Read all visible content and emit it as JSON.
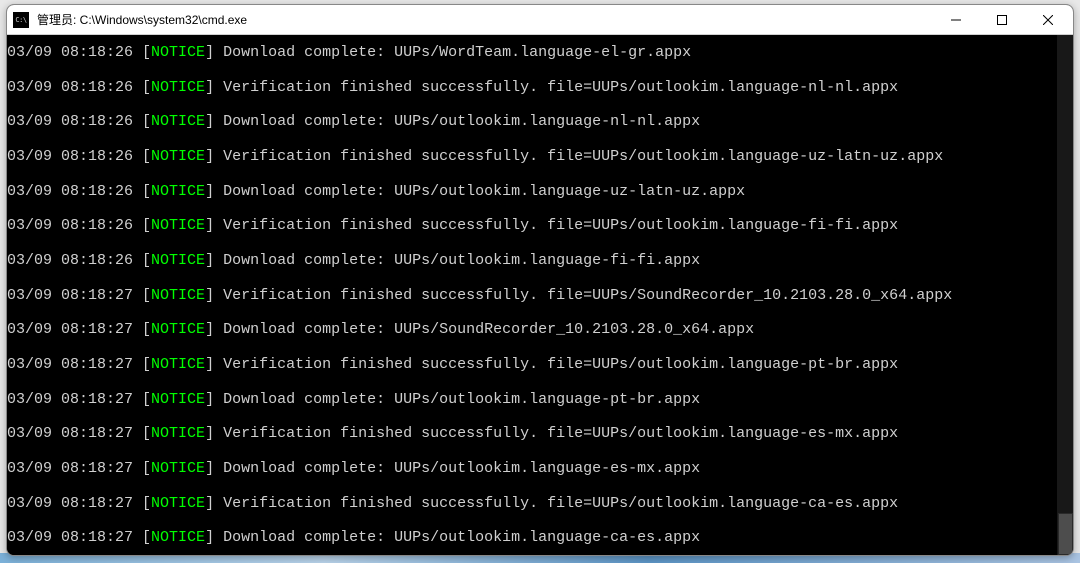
{
  "window": {
    "title": "管理员: C:\\Windows\\system32\\cmd.exe",
    "icon_label": "C:\\"
  },
  "log": [
    {
      "ts": "03/09 08:18:26",
      "level": "NOTICE",
      "msg": "Download complete: UUPs/WordTeam.language-el-gr.appx"
    },
    {
      "ts": "03/09 08:18:26",
      "level": "NOTICE",
      "msg": "Verification finished successfully. file=UUPs/outlookim.language-nl-nl.appx"
    },
    {
      "ts": "03/09 08:18:26",
      "level": "NOTICE",
      "msg": "Download complete: UUPs/outlookim.language-nl-nl.appx"
    },
    {
      "ts": "03/09 08:18:26",
      "level": "NOTICE",
      "msg": "Verification finished successfully. file=UUPs/outlookim.language-uz-latn-uz.appx"
    },
    {
      "ts": "03/09 08:18:26",
      "level": "NOTICE",
      "msg": "Download complete: UUPs/outlookim.language-uz-latn-uz.appx"
    },
    {
      "ts": "03/09 08:18:26",
      "level": "NOTICE",
      "msg": "Verification finished successfully. file=UUPs/outlookim.language-fi-fi.appx"
    },
    {
      "ts": "03/09 08:18:26",
      "level": "NOTICE",
      "msg": "Download complete: UUPs/outlookim.language-fi-fi.appx"
    },
    {
      "ts": "03/09 08:18:27",
      "level": "NOTICE",
      "msg": "Verification finished successfully. file=UUPs/SoundRecorder_10.2103.28.0_x64.appx"
    },
    {
      "ts": "03/09 08:18:27",
      "level": "NOTICE",
      "msg": "Download complete: UUPs/SoundRecorder_10.2103.28.0_x64.appx"
    },
    {
      "ts": "03/09 08:18:27",
      "level": "NOTICE",
      "msg": "Verification finished successfully. file=UUPs/outlookim.language-pt-br.appx"
    },
    {
      "ts": "03/09 08:18:27",
      "level": "NOTICE",
      "msg": "Download complete: UUPs/outlookim.language-pt-br.appx"
    },
    {
      "ts": "03/09 08:18:27",
      "level": "NOTICE",
      "msg": "Verification finished successfully. file=UUPs/outlookim.language-es-mx.appx"
    },
    {
      "ts": "03/09 08:18:27",
      "level": "NOTICE",
      "msg": "Download complete: UUPs/outlookim.language-es-mx.appx"
    },
    {
      "ts": "03/09 08:18:27",
      "level": "NOTICE",
      "msg": "Verification finished successfully. file=UUPs/outlookim.language-ca-es.appx"
    },
    {
      "ts": "03/09 08:18:27",
      "level": "NOTICE",
      "msg": "Download complete: UUPs/outlookim.language-ca-es.appx"
    }
  ]
}
